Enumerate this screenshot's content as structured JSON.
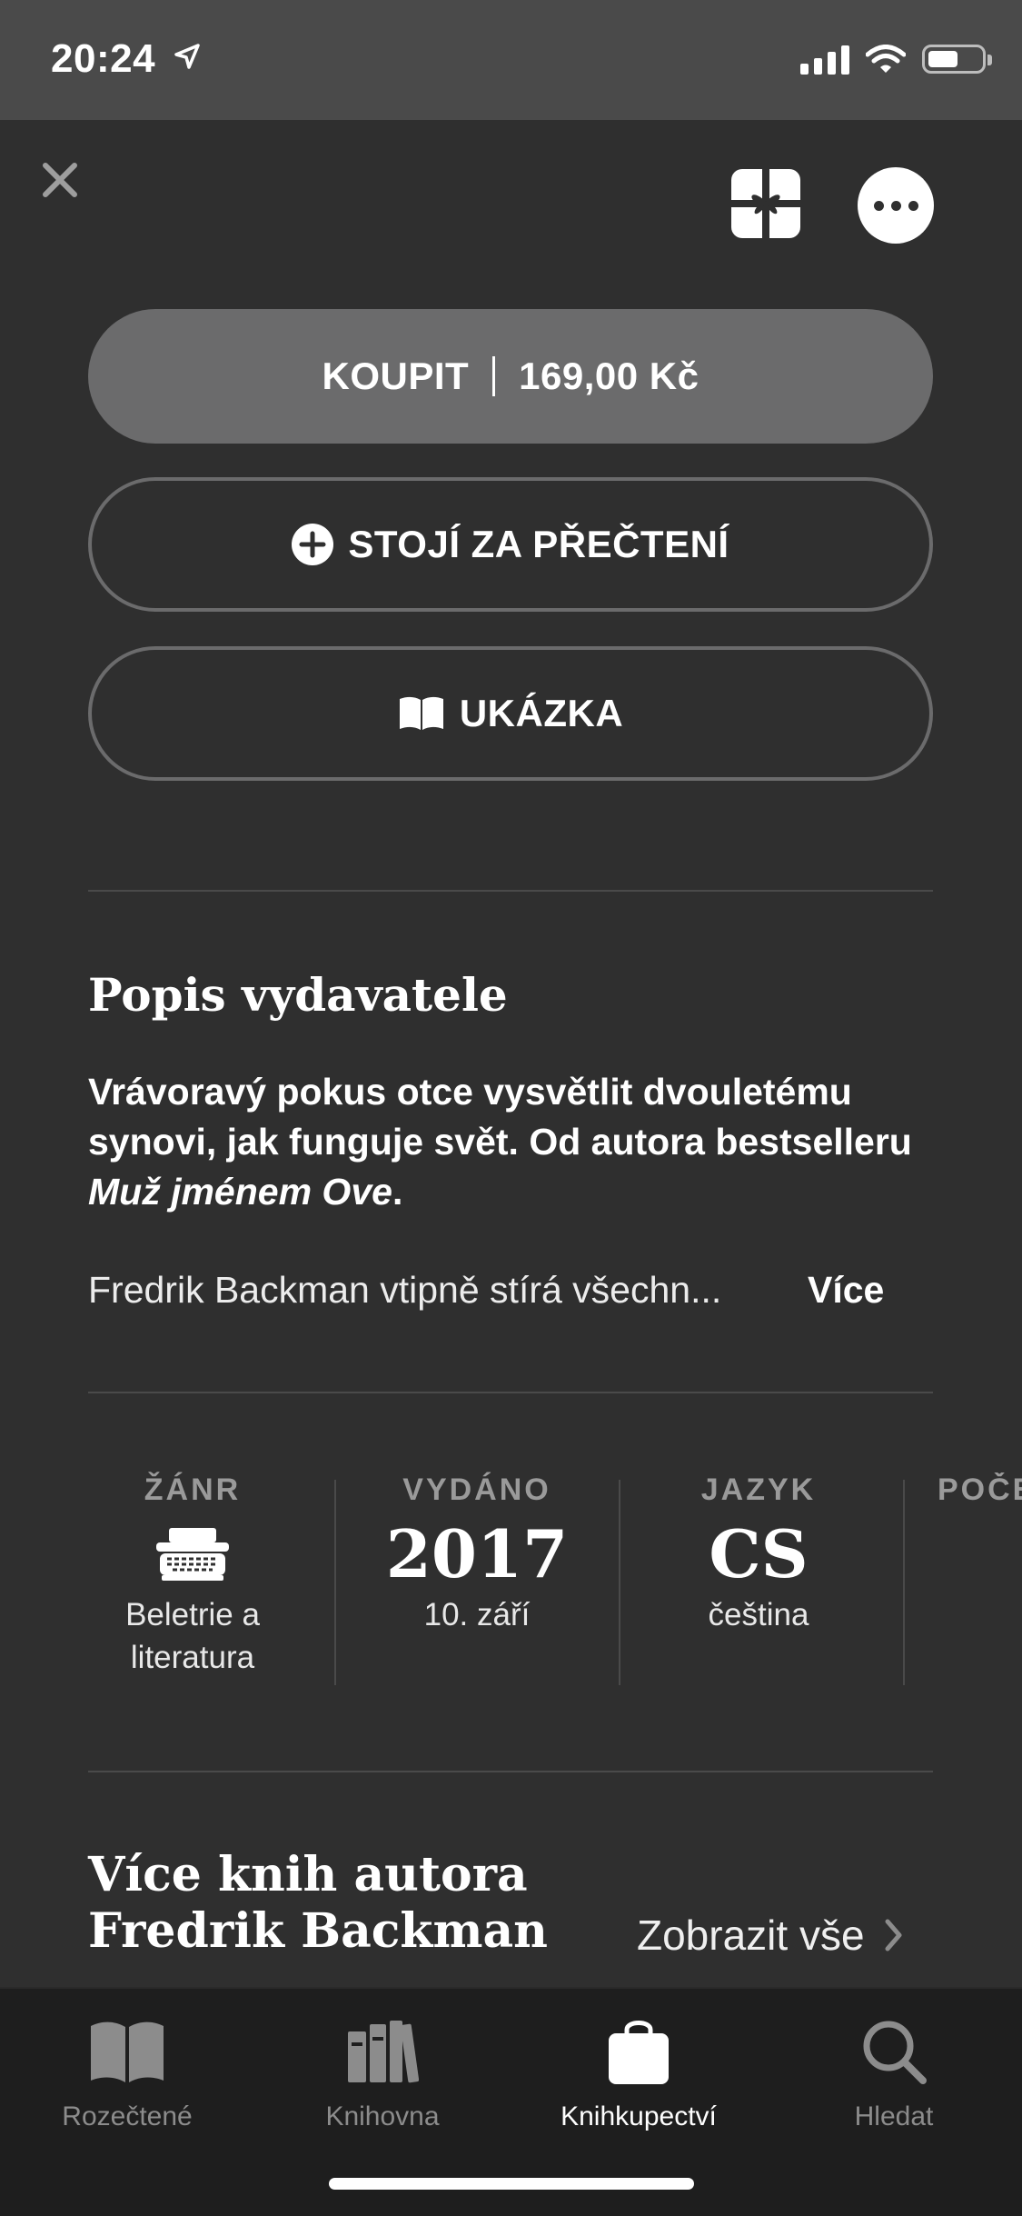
{
  "status_bar": {
    "time": "20:24"
  },
  "header": {
    "close_icon": "close-icon",
    "gift_icon": "gift-icon",
    "more_icon": "more-icon"
  },
  "actions": {
    "buy_label": "KOUPIT",
    "buy_price": "169,00 Kč",
    "want_to_read_label": "STOJÍ ZA PŘEČTENÍ",
    "sample_label": "UKÁZKA"
  },
  "publisher_description": {
    "title": "Popis vydavatele",
    "summary_part1": "Vrávoravý pokus otce vysvětlit dvouletému synovi, jak funguje svět. Od autora bestselleru ",
    "summary_italic": "Muž jménem Ove",
    "summary_end": ".",
    "excerpt": "Fredrik Backman vtipně stírá všechn...",
    "more_label": "Více"
  },
  "info": {
    "genre": {
      "label": "ŽÁNR",
      "value_line1": "Beletrie a",
      "value_line2": "literatura",
      "icon": "typewriter-icon"
    },
    "released": {
      "label": "VYDÁNO",
      "year": "2017",
      "date": "10. září"
    },
    "language": {
      "label": "JAZYK",
      "code": "CS",
      "name": "čeština"
    },
    "pages": {
      "label": "POČE"
    }
  },
  "more_by_author": {
    "title_line1": "Více knih autora",
    "title_line2": "Fredrik Backman",
    "show_all": "Zobrazit vše"
  },
  "tabs": [
    {
      "label": "Rozečtené",
      "icon": "open-book-icon",
      "active": false
    },
    {
      "label": "Knihovna",
      "icon": "library-icon",
      "active": false
    },
    {
      "label": "Knihkupectví",
      "icon": "shopping-bag-icon",
      "active": true
    },
    {
      "label": "Hledat",
      "icon": "search-icon",
      "active": false
    }
  ],
  "colors": {
    "background": "#2f2f2f",
    "button_fill": "#6b6b6c",
    "tab_bar": "#1e1e1e",
    "muted_label": "#9a9a9a"
  }
}
